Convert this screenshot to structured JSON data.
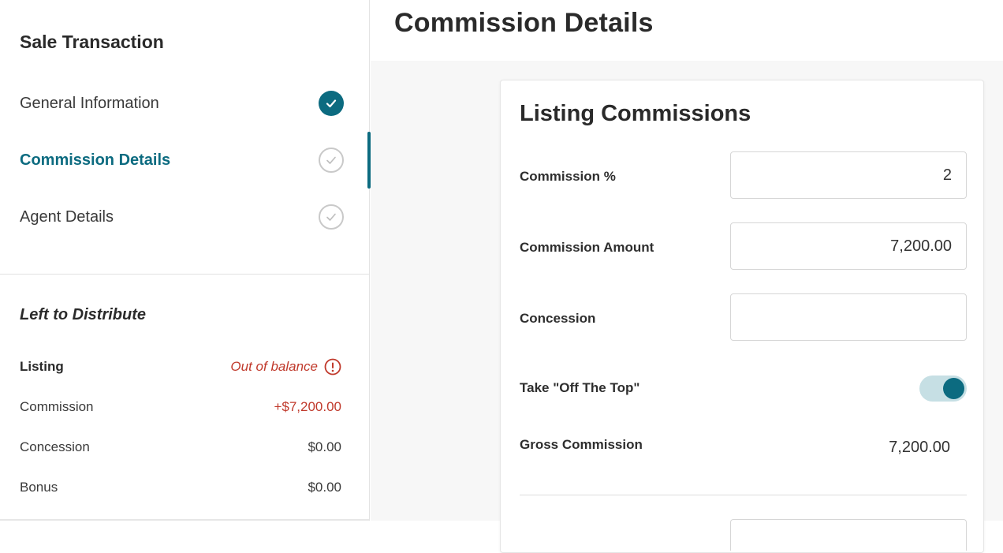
{
  "page": {
    "title": "Commission Details"
  },
  "sidebar": {
    "title": "Sale Transaction",
    "steps": [
      {
        "label": "General Information",
        "status": "complete"
      },
      {
        "label": "Commission Details",
        "status": "active"
      },
      {
        "label": "Agent Details",
        "status": "incomplete"
      }
    ],
    "distribution": {
      "title": "Left to Distribute",
      "section_label": "Listing",
      "status_text": "Out of balance",
      "rows": [
        {
          "label": "Commission",
          "value": "+$7,200.00"
        },
        {
          "label": "Concession",
          "value": "$0.00"
        },
        {
          "label": "Bonus",
          "value": "$0.00"
        }
      ]
    }
  },
  "card": {
    "title": "Listing Commissions",
    "fields": {
      "commission_percent": {
        "label": "Commission %",
        "value": "2"
      },
      "commission_amount": {
        "label": "Commission Amount",
        "value": "7,200.00"
      },
      "concession": {
        "label": "Concession",
        "value": ""
      },
      "off_the_top": {
        "label": "Take \"Off The Top\"",
        "enabled": true
      },
      "gross_commission": {
        "label": "Gross Commission",
        "value": "7,200.00"
      }
    }
  },
  "colors": {
    "accent": "#0c6b80",
    "error": "#c0392b",
    "toggle_track": "#c6dfe4"
  },
  "icons": {
    "step_complete": "check-circle-filled-icon",
    "step_incomplete": "check-circle-outline-icon",
    "out_of_balance": "exclamation-circle-icon"
  }
}
